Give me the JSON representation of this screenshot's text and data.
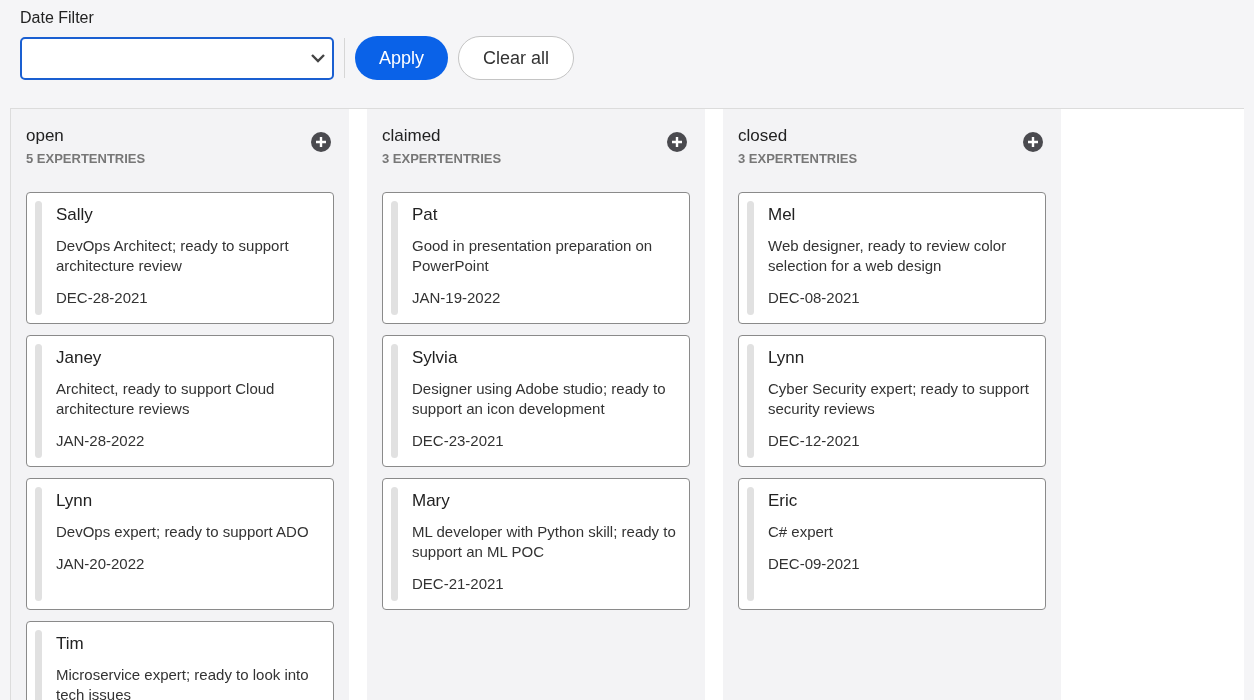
{
  "filter": {
    "label": "Date Filter",
    "apply": "Apply",
    "clear": "Clear all"
  },
  "columns": [
    {
      "title": "open",
      "count": "5 EXPERTENTRIES",
      "cards": [
        {
          "name": "Sally",
          "description": "DevOps Architect; ready to support architecture review",
          "date": "DEC-28-2021"
        },
        {
          "name": "Janey",
          "description": "Architect, ready to support Cloud architecture reviews",
          "date": "JAN-28-2022"
        },
        {
          "name": "Lynn",
          "description": "DevOps expert; ready to support ADO",
          "date": "JAN-20-2022"
        },
        {
          "name": "Tim",
          "description": "Microservice expert; ready to look into tech issues"
        }
      ]
    },
    {
      "title": "claimed",
      "count": "3 EXPERTENTRIES",
      "cards": [
        {
          "name": "Pat",
          "description": "Good in presentation preparation on PowerPoint",
          "date": "JAN-19-2022"
        },
        {
          "name": "Sylvia",
          "description": "Designer using Adobe studio; ready to support an icon development",
          "date": "DEC-23-2021"
        },
        {
          "name": "Mary",
          "description": "ML developer with Python skill; ready to support an ML POC",
          "date": "DEC-21-2021"
        }
      ]
    },
    {
      "title": "closed",
      "count": "3 EXPERTENTRIES",
      "cards": [
        {
          "name": "Mel",
          "description": "Web designer, ready to review color selection for a web design",
          "date": "DEC-08-2021"
        },
        {
          "name": "Lynn",
          "description": "Cyber Security expert; ready to support security reviews",
          "date": "DEC-12-2021"
        },
        {
          "name": "Eric",
          "description": "C# expert",
          "date": "DEC-09-2021"
        }
      ]
    }
  ]
}
